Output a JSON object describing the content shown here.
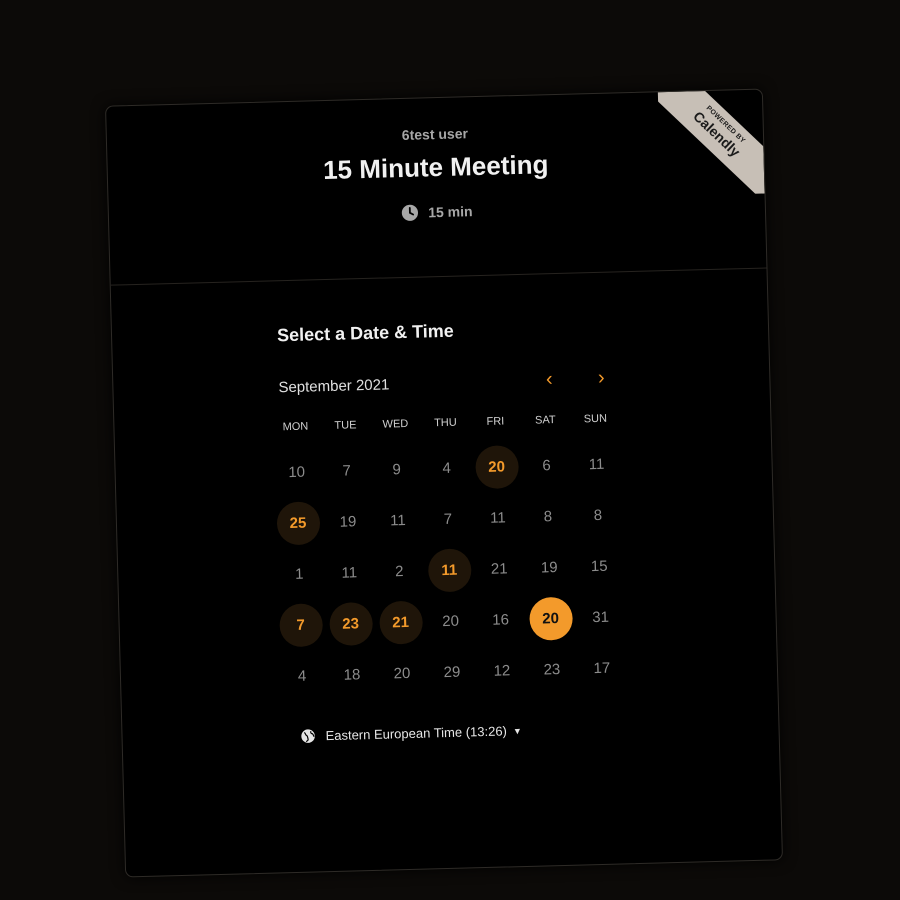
{
  "header": {
    "host_name": "6test user",
    "event_title": "15 Minute Meeting",
    "duration": "15 min",
    "badge_top": "POWERED BY",
    "badge_brand": "Calendly"
  },
  "scheduler": {
    "title": "Select a Date & Time",
    "month": "September 2021",
    "prev_icon": "‹",
    "next_icon": "›",
    "weekdays": [
      "MON",
      "TUE",
      "WED",
      "THU",
      "FRI",
      "SAT",
      "SUN"
    ],
    "weeks": [
      [
        {
          "n": "10"
        },
        {
          "n": "7"
        },
        {
          "n": "9"
        },
        {
          "n": "4"
        },
        {
          "n": "20",
          "s": "avail"
        },
        {
          "n": "6"
        },
        {
          "n": "11"
        }
      ],
      [
        {
          "n": "25",
          "s": "avail"
        },
        {
          "n": "19"
        },
        {
          "n": "11"
        },
        {
          "n": "7"
        },
        {
          "n": "11"
        },
        {
          "n": "8"
        },
        {
          "n": "8"
        }
      ],
      [
        {
          "n": "1"
        },
        {
          "n": "11"
        },
        {
          "n": "2"
        },
        {
          "n": "11",
          "s": "avail"
        },
        {
          "n": "21"
        },
        {
          "n": "19"
        },
        {
          "n": "15"
        }
      ],
      [
        {
          "n": "7",
          "s": "avail"
        },
        {
          "n": "23",
          "s": "avail"
        },
        {
          "n": "21",
          "s": "avail"
        },
        {
          "n": "20"
        },
        {
          "n": "16"
        },
        {
          "n": "20",
          "s": "selected"
        },
        {
          "n": "31"
        }
      ],
      [
        {
          "n": "4"
        },
        {
          "n": "18"
        },
        {
          "n": "20"
        },
        {
          "n": "29"
        },
        {
          "n": "12"
        },
        {
          "n": "23"
        },
        {
          "n": "17"
        }
      ]
    ],
    "timezone": "Eastern European Time (13:26)",
    "timezone_caret": "▼"
  },
  "colors": {
    "accent": "#f39a2b",
    "available_bg": "#1f1509",
    "background": "#000000"
  },
  "icons": {
    "duration": "clock-icon",
    "timezone": "globe-icon",
    "prev": "chevron-left-icon",
    "next": "chevron-right-icon"
  }
}
